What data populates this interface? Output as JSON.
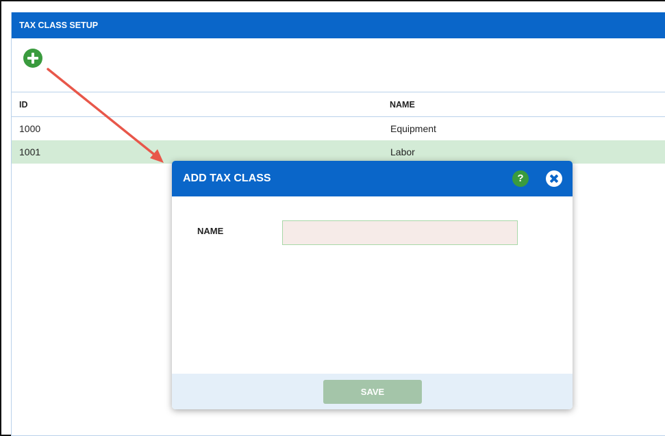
{
  "panel": {
    "title": "TAX CLASS SETUP"
  },
  "table": {
    "columns": [
      "ID",
      "NAME"
    ],
    "rows": [
      {
        "id": "1000",
        "name": "Equipment"
      },
      {
        "id": "1001",
        "name": "Labor"
      }
    ]
  },
  "modal": {
    "title": "ADD TAX CLASS",
    "help_label": "?",
    "name_label": "NAME",
    "name_value": "",
    "save_label": "SAVE"
  },
  "colors": {
    "header_blue": "#0a66c9",
    "add_green": "#3a9b3e",
    "selected_row": "#d3ebd6",
    "arrow_red": "#e8574a",
    "save_disabled": "#a4c5a9"
  }
}
